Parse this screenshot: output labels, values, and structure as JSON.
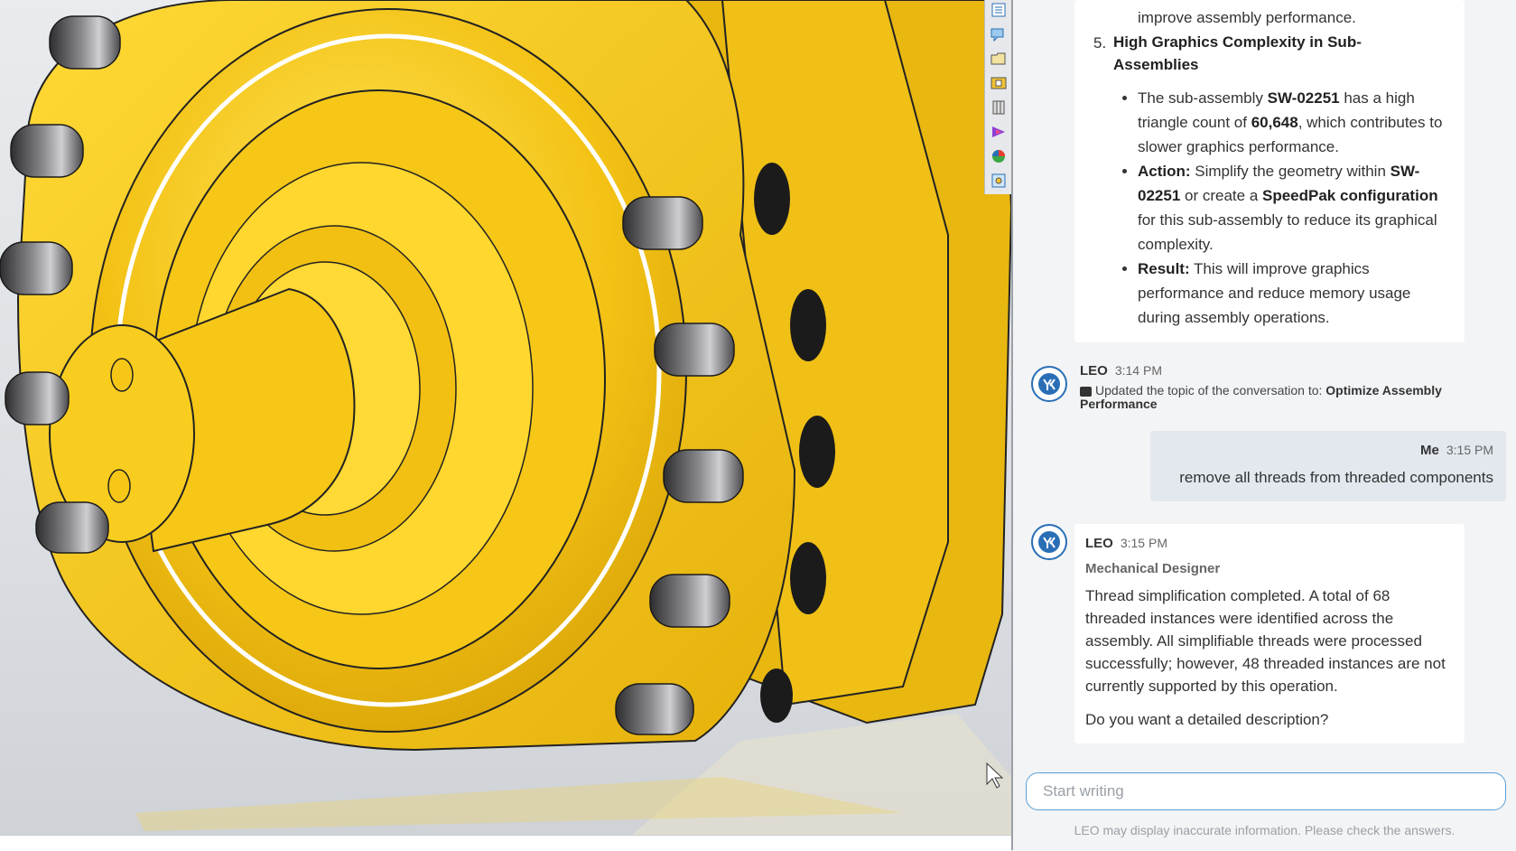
{
  "chat": {
    "prev_message": {
      "line_top": "improve assembly performance.",
      "item_number": "5.",
      "item_title": "High Graphics Complexity in Sub-Assemblies",
      "item_title_line1": "High Graphics Complexity in Sub-",
      "item_title_line2": "Assemblies",
      "bullet1": {
        "t1": "The sub-assembly ",
        "b1": "SW-02251",
        "t2": " has a high triangle count of ",
        "b2": "60,648",
        "t3": ", which contributes to slower graphics performance."
      },
      "bullet2": {
        "label": "Action:",
        "t1": " Simplify the geometry within ",
        "b1": "SW-02251",
        "t2": " or create a ",
        "b2": "SpeedPak configuration",
        "t3": " for this sub-assembly to reduce its graphical complexity."
      },
      "bullet3": {
        "label": "Result:",
        "t1": " This will improve graphics performance and reduce memory usage during assembly operations."
      }
    },
    "topic_update": {
      "sender": "LEO",
      "time": "3:14 PM",
      "text": "Updated the topic of the conversation to: ",
      "topic": "Optimize Assembly Performance"
    },
    "user_message": {
      "sender": "Me",
      "time": "3:15 PM",
      "text": "remove all threads from threaded components"
    },
    "reply": {
      "sender": "LEO",
      "time": "3:15 PM",
      "role": "Mechanical Designer",
      "paragraph": "Thread simplification completed. A total of 68 threaded instances were identified across the assembly. All simplifiable threads were processed successfully; however, 48 threaded instances are not currently supported by this operation.",
      "question": "Do you want a detailed description?"
    },
    "input_placeholder": "Start writing",
    "disclaimer": "LEO may display inaccurate information. Please check the answers."
  },
  "colors": {
    "part_yellow": "#f3c215",
    "accent_blue": "#2a6fb6",
    "user_bubble": "#e2e8ee"
  },
  "taskpane_icons": [
    "resources-icon",
    "forum-icon",
    "file-explorer-icon",
    "toolbox-icon",
    "design-library-icon",
    "3dexperience-icon",
    "appearances-icon",
    "custom-properties-icon"
  ]
}
